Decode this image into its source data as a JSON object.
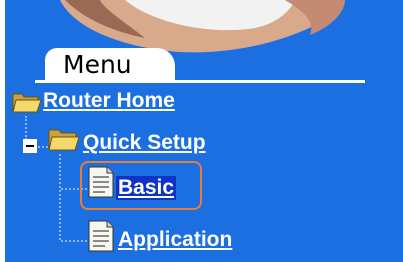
{
  "menu": {
    "title": "Menu"
  },
  "tree": {
    "router_home": "Router Home",
    "quick_setup": "Quick Setup",
    "basic": "Basic",
    "application": "Application"
  },
  "icons": {
    "router_home": "folder-open-icon",
    "quick_setup": "folder-open-icon",
    "collapse": "minus-box-icon",
    "basic": "document-icon",
    "application": "document-icon"
  },
  "colors": {
    "panel_bg": "#1c6fe0",
    "link_text": "#ffffff",
    "selected_bg": "#1033c7",
    "highlight_border": "#e97e35"
  },
  "state": {
    "selected_item": "Basic"
  }
}
